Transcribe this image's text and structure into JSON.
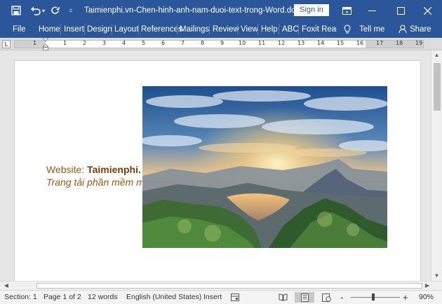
{
  "titlebar": {
    "title": "Taimienphi.vn-Chen-hinh-anh-nam-duoi-text-trong-Word.doc...",
    "signin": "Sign in",
    "qat": [
      "save-icon",
      "undo-icon",
      "redo-icon",
      "customize-qat-icon"
    ]
  },
  "ribbon": {
    "tabs": [
      "File",
      "Home",
      "Insert",
      "Design",
      "Layout",
      "References",
      "Mailings",
      "Review",
      "View",
      "Help",
      "ABC",
      "Foxit Reade"
    ],
    "tell_me": "Tell me",
    "share": "Share"
  },
  "ruler": {
    "tab_marker": "L",
    "numbers": [
      "1",
      "1",
      "2",
      "3",
      "4",
      "5",
      "6",
      "7",
      "8",
      "9",
      "10",
      "11",
      "12",
      "13",
      "14",
      "15",
      "16",
      "17",
      "18",
      "19"
    ]
  },
  "document": {
    "line1_prefix": "Website: ",
    "line1_bold": "Taimienphi.",
    "line2": "Trang tải phần mềm m"
  },
  "statusbar": {
    "section": "Section: 1",
    "page": "Page 1 of 2",
    "words": "12 words",
    "language": "English (United States)",
    "mode": "Insert",
    "zoom_minus": "-",
    "zoom_plus": "+",
    "zoom": "90%"
  },
  "colors": {
    "brand": "#2b579a",
    "text_accent": "#9c5a12"
  }
}
